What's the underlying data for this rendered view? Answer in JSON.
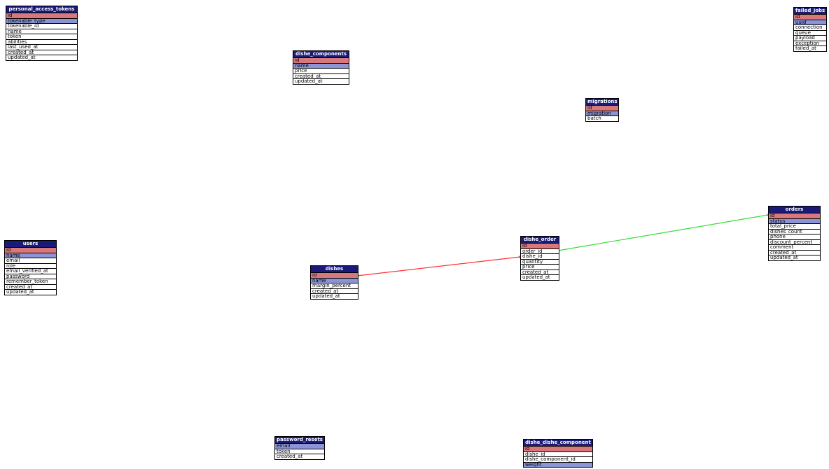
{
  "tables": [
    {
      "key": "personal_access_tokens",
      "title": "personal_access_tokens",
      "rows": [
        {
          "name": "id",
          "kind": "pk"
        },
        {
          "name": "tokenable_type",
          "kind": "uk"
        },
        {
          "name": "tokenable_id",
          "kind": ""
        },
        {
          "name": "name",
          "kind": ""
        },
        {
          "name": "token",
          "kind": ""
        },
        {
          "name": "abilities",
          "kind": ""
        },
        {
          "name": "last_used_at",
          "kind": ""
        },
        {
          "name": "created_at",
          "kind": ""
        },
        {
          "name": "updated_at",
          "kind": ""
        }
      ]
    },
    {
      "key": "dishe_components",
      "title": "dishe_components",
      "rows": [
        {
          "name": "id",
          "kind": "pk"
        },
        {
          "name": "name",
          "kind": "uk"
        },
        {
          "name": "price",
          "kind": ""
        },
        {
          "name": "created_at",
          "kind": ""
        },
        {
          "name": "updated_at",
          "kind": ""
        }
      ]
    },
    {
      "key": "migrations",
      "title": "migrations",
      "rows": [
        {
          "name": "id",
          "kind": "pk"
        },
        {
          "name": "migration",
          "kind": "uk"
        },
        {
          "name": "batch",
          "kind": ""
        }
      ]
    },
    {
      "key": "failed_jobs",
      "title": "failed_jobs",
      "rows": [
        {
          "name": "id",
          "kind": "pk"
        },
        {
          "name": "uuid",
          "kind": "uk"
        },
        {
          "name": "connection",
          "kind": ""
        },
        {
          "name": "queue",
          "kind": ""
        },
        {
          "name": "payload",
          "kind": ""
        },
        {
          "name": "exception",
          "kind": ""
        },
        {
          "name": "failed_at",
          "kind": ""
        }
      ]
    },
    {
      "key": "users",
      "title": "users",
      "rows": [
        {
          "name": "id",
          "kind": "pk"
        },
        {
          "name": "name",
          "kind": "uk"
        },
        {
          "name": "email",
          "kind": ""
        },
        {
          "name": "role",
          "kind": ""
        },
        {
          "name": "email_verified_at",
          "kind": ""
        },
        {
          "name": "password",
          "kind": ""
        },
        {
          "name": "remember_token",
          "kind": ""
        },
        {
          "name": "created_at",
          "kind": ""
        },
        {
          "name": "updated_at",
          "kind": ""
        }
      ]
    },
    {
      "key": "dishes",
      "title": "dishes",
      "rows": [
        {
          "name": "id",
          "kind": "pk"
        },
        {
          "name": "name",
          "kind": "uk"
        },
        {
          "name": "margin_percent",
          "kind": ""
        },
        {
          "name": "created_at",
          "kind": ""
        },
        {
          "name": "updated_at",
          "kind": ""
        }
      ]
    },
    {
      "key": "dishe_order",
      "title": "dishe_order",
      "rows": [
        {
          "name": "id",
          "kind": "pk"
        },
        {
          "name": "order_id",
          "kind": ""
        },
        {
          "name": "dishe_id",
          "kind": ""
        },
        {
          "name": "quantity",
          "kind": ""
        },
        {
          "name": "price",
          "kind": ""
        },
        {
          "name": "created_at",
          "kind": ""
        },
        {
          "name": "updated_at",
          "kind": ""
        }
      ]
    },
    {
      "key": "orders",
      "title": "orders",
      "rows": [
        {
          "name": "id",
          "kind": "pk"
        },
        {
          "name": "status",
          "kind": "uk"
        },
        {
          "name": "total_price",
          "kind": ""
        },
        {
          "name": "dishes_count",
          "kind": ""
        },
        {
          "name": "phone",
          "kind": ""
        },
        {
          "name": "discount_percent",
          "kind": ""
        },
        {
          "name": "comment",
          "kind": ""
        },
        {
          "name": "created_at",
          "kind": ""
        },
        {
          "name": "updated_at",
          "kind": ""
        }
      ]
    },
    {
      "key": "password_resets",
      "title": "password_resets",
      "rows": [
        {
          "name": "email",
          "kind": "uk"
        },
        {
          "name": "token",
          "kind": ""
        },
        {
          "name": "created_at",
          "kind": ""
        }
      ]
    },
    {
      "key": "dishe_dishe_component",
      "title": "dishe_dishe_component",
      "rows": [
        {
          "name": "id",
          "kind": "pk"
        },
        {
          "name": "dishe_id",
          "kind": ""
        },
        {
          "name": "dishe_component_id",
          "kind": ""
        },
        {
          "name": "weight",
          "kind": "uk"
        }
      ]
    }
  ],
  "relations": [
    {
      "from": "dishe_order",
      "to": "dishes",
      "color": "#ff3030"
    },
    {
      "from": "dishe_order",
      "to": "orders",
      "color": "#33dd33"
    }
  ]
}
